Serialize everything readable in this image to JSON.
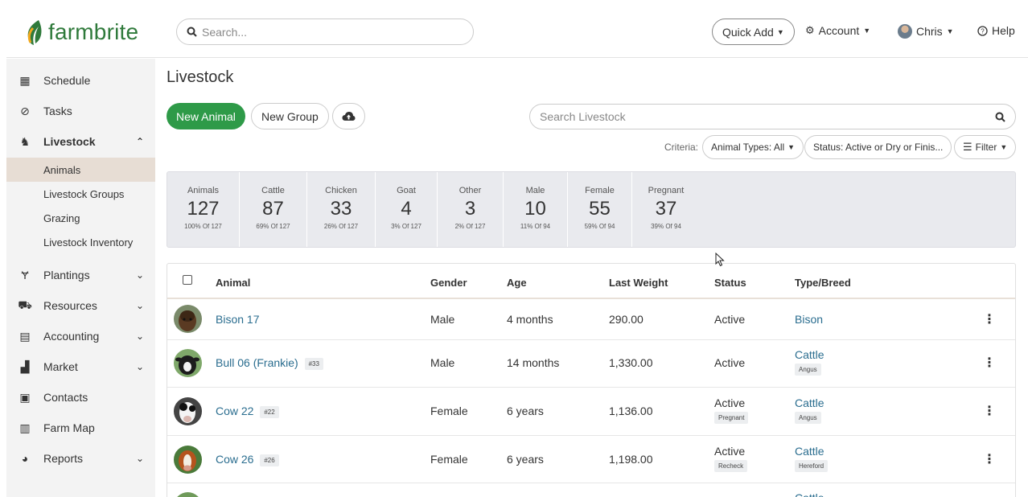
{
  "brand": {
    "name": "farmbrite"
  },
  "topbar": {
    "search_placeholder": "Search...",
    "quick_add": "Quick Add",
    "account": "Account",
    "user": "Chris",
    "help": "Help"
  },
  "sidebar": {
    "items": [
      {
        "label": "Schedule",
        "icon": "calendar-icon"
      },
      {
        "label": "Tasks",
        "icon": "check-circle-icon"
      },
      {
        "label": "Livestock",
        "icon": "horse-head-icon"
      },
      {
        "label": "Plantings",
        "icon": "seedling-icon"
      },
      {
        "label": "Resources",
        "icon": "tractor-icon"
      },
      {
        "label": "Accounting",
        "icon": "calculator-icon"
      },
      {
        "label": "Market",
        "icon": "store-icon"
      },
      {
        "label": "Contacts",
        "icon": "address-book-icon"
      },
      {
        "label": "Farm Map",
        "icon": "map-icon"
      },
      {
        "label": "Reports",
        "icon": "pie-chart-icon"
      }
    ],
    "livestock_sub": [
      "Animals",
      "Livestock Groups",
      "Grazing",
      "Livestock Inventory"
    ]
  },
  "main": {
    "title": "Livestock",
    "new_animal": "New Animal",
    "new_group": "New Group",
    "search_placeholder": "Search Livestock",
    "criteria_label": "Criteria:",
    "filter_animal_types": "Animal Types: All",
    "filter_status": "Status: Active or Dry or Finis...",
    "filter_button": "Filter"
  },
  "stats": [
    {
      "label": "Animals",
      "value": "127",
      "sub": "100% Of 127"
    },
    {
      "label": "Cattle",
      "value": "87",
      "sub": "69% Of 127"
    },
    {
      "label": "Chicken",
      "value": "33",
      "sub": "26% Of 127"
    },
    {
      "label": "Goat",
      "value": "4",
      "sub": "3% Of 127"
    },
    {
      "label": "Other",
      "value": "3",
      "sub": "2% Of 127"
    },
    {
      "label": "Male",
      "value": "10",
      "sub": "11% Of 94"
    },
    {
      "label": "Female",
      "value": "55",
      "sub": "59% Of 94"
    },
    {
      "label": "Pregnant",
      "value": "37",
      "sub": "39% Of 94"
    }
  ],
  "table": {
    "columns": [
      "Animal",
      "Gender",
      "Age",
      "Last Weight",
      "Status",
      "Type/Breed"
    ],
    "rows": [
      {
        "name": "Bison 17",
        "tag": "",
        "gender": "Male",
        "age": "4 months",
        "weight": "290.00",
        "status": "Active",
        "status_tag": "",
        "type": "Bison",
        "breed": ""
      },
      {
        "name": "Bull 06 (Frankie)",
        "tag": "#33",
        "gender": "Male",
        "age": "14 months",
        "weight": "1,330.00",
        "status": "Active",
        "status_tag": "",
        "type": "Cattle",
        "breed": "Angus"
      },
      {
        "name": "Cow 22",
        "tag": "#22",
        "gender": "Female",
        "age": "6 years",
        "weight": "1,136.00",
        "status": "Active",
        "status_tag": "Pregnant",
        "type": "Cattle",
        "breed": "Angus"
      },
      {
        "name": "Cow 26",
        "tag": "#26",
        "gender": "Female",
        "age": "6 years",
        "weight": "1,198.00",
        "status": "Active",
        "status_tag": "Recheck",
        "type": "Cattle",
        "breed": "Hereford"
      },
      {
        "name": "",
        "tag": "",
        "gender": "",
        "age": "",
        "weight": "",
        "status": "",
        "status_tag": "",
        "type": "Cattle",
        "breed": ""
      }
    ]
  },
  "colors": {
    "brand_green": "#2e9a48",
    "link": "#2a6d8f",
    "sidebar_bg": "#f3f3f3",
    "selected_bg": "#e7ddd4"
  }
}
